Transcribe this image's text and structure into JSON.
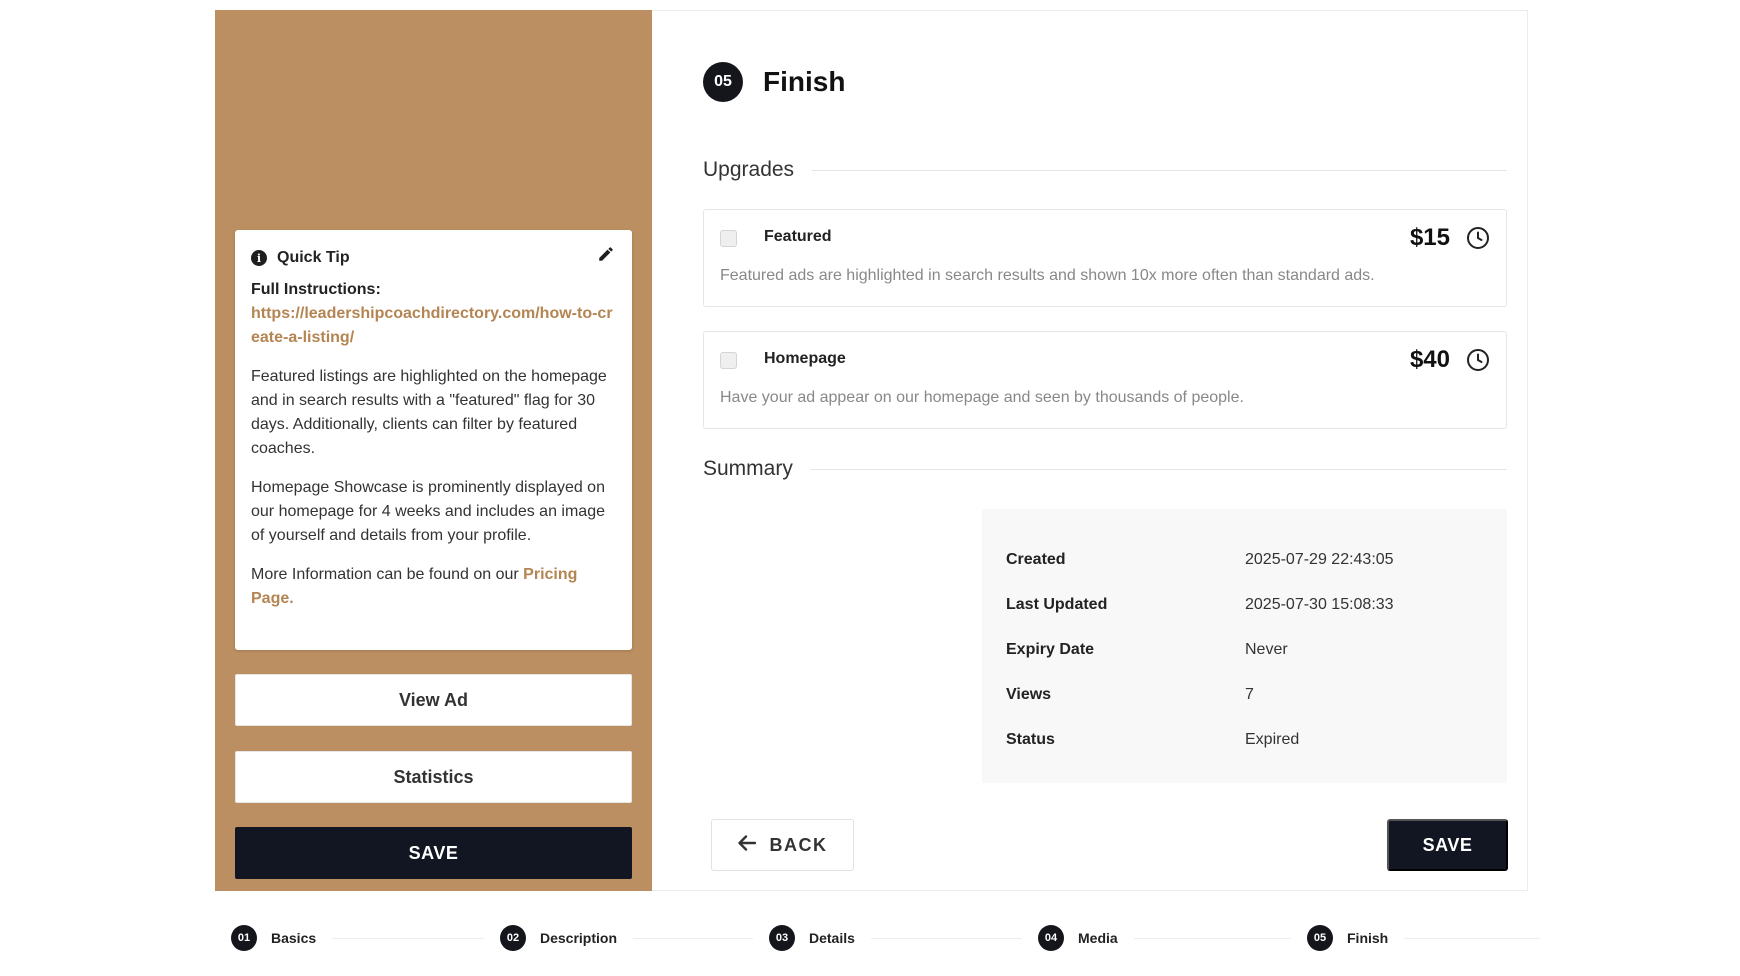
{
  "sidebar": {
    "tip": {
      "title": "Quick Tip",
      "instructions_label": "Full Instructions:",
      "instructions_link": "https://leadershipcoachdirectory.com/how-to-create-a-listing/",
      "para1": "Featured listings are highlighted on the homepage and in search results with a \"featured\" flag for 30 days. Additionally, clients can filter by featured coaches.",
      "para2": "Homepage Showcase is prominently displayed on our homepage for 4 weeks and includes an image of yourself and details from your profile.",
      "para3_prefix": "More Information can be found on our ",
      "para3_link": "Pricing Page."
    },
    "view_ad_label": "View Ad",
    "statistics_label": "Statistics",
    "save_label": "SAVE",
    "accent_color": "#bb8f61"
  },
  "main": {
    "step_number": "05",
    "step_title": "Finish",
    "upgrades_title": "Upgrades",
    "upgrades": [
      {
        "name": "Featured",
        "price": "$15",
        "description": "Featured ads are highlighted in search results and shown 10x more often than standard ads.",
        "checked": false
      },
      {
        "name": "Homepage",
        "price": "$40",
        "description": "Have your ad appear on our homepage and seen by thousands of people.",
        "checked": false
      }
    ],
    "summary_title": "Summary",
    "summary": [
      {
        "label": "Created",
        "value": "2025-07-29 22:43:05"
      },
      {
        "label": "Last Updated",
        "value": "2025-07-30 15:08:33"
      },
      {
        "label": "Expiry Date",
        "value": "Never"
      },
      {
        "label": "Views",
        "value": "7"
      },
      {
        "label": "Status",
        "value": "Expired"
      }
    ],
    "back_label": "BACK",
    "save_label": "SAVE"
  },
  "stepper": [
    {
      "num": "01",
      "label": "Basics"
    },
    {
      "num": "02",
      "label": "Description"
    },
    {
      "num": "03",
      "label": "Details"
    },
    {
      "num": "04",
      "label": "Media"
    },
    {
      "num": "05",
      "label": "Finish"
    }
  ]
}
